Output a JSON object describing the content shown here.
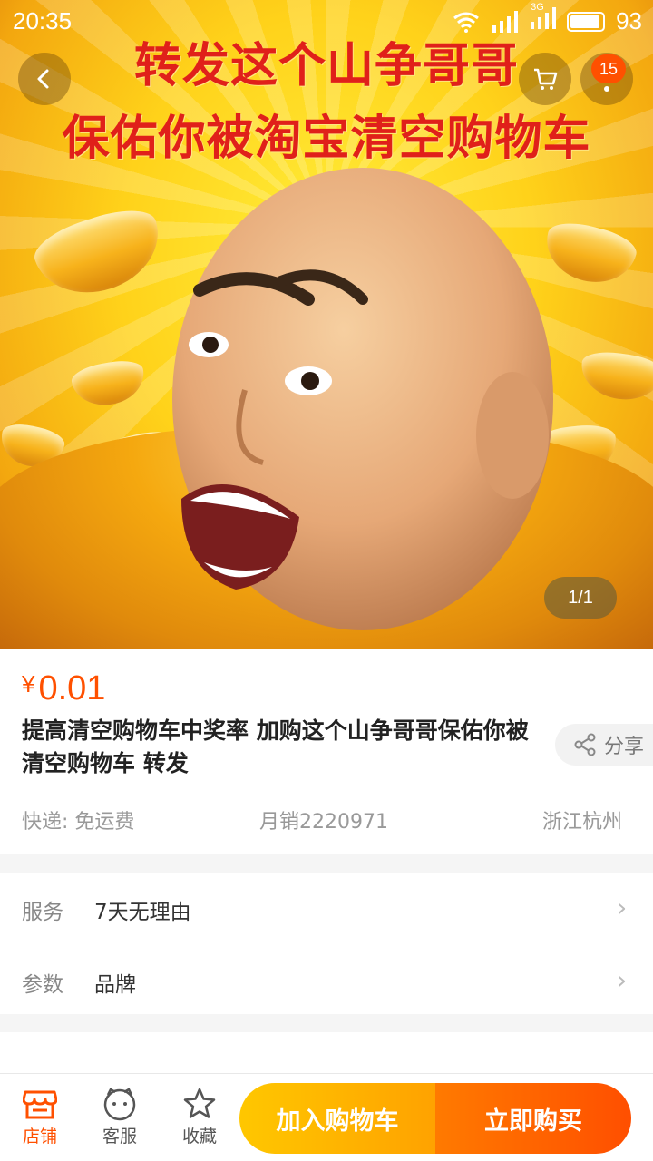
{
  "status_bar": {
    "time": "20:35",
    "network": "3G",
    "battery": "93"
  },
  "hero": {
    "banner_line1": "转发这个山争哥哥",
    "banner_line2": "保佑你被淘宝清空购物车",
    "page_indicator": "1/1"
  },
  "header": {
    "cart_badge": "15"
  },
  "product": {
    "currency": "¥",
    "price": "0.01",
    "title": "提高清空购物车中奖率 加购这个山争哥哥保佑你被清空购物车 转发",
    "share_label": "分享",
    "shipping": "快递: 免运费",
    "monthly_sales": "月销2220971",
    "location": "浙江杭州"
  },
  "rows": [
    {
      "label": "服务",
      "value": "7天无理由"
    },
    {
      "label": "参数",
      "value": "品牌"
    }
  ],
  "bottom_bar": {
    "shop_label": "店铺",
    "service_label": "客服",
    "favorite_label": "收藏",
    "add_to_cart": "加入购物车",
    "buy_now": "立即购买"
  },
  "colors": {
    "accent": "#ff5000",
    "cart_button": "#ffb000",
    "buy_button": "#ff5a00"
  }
}
